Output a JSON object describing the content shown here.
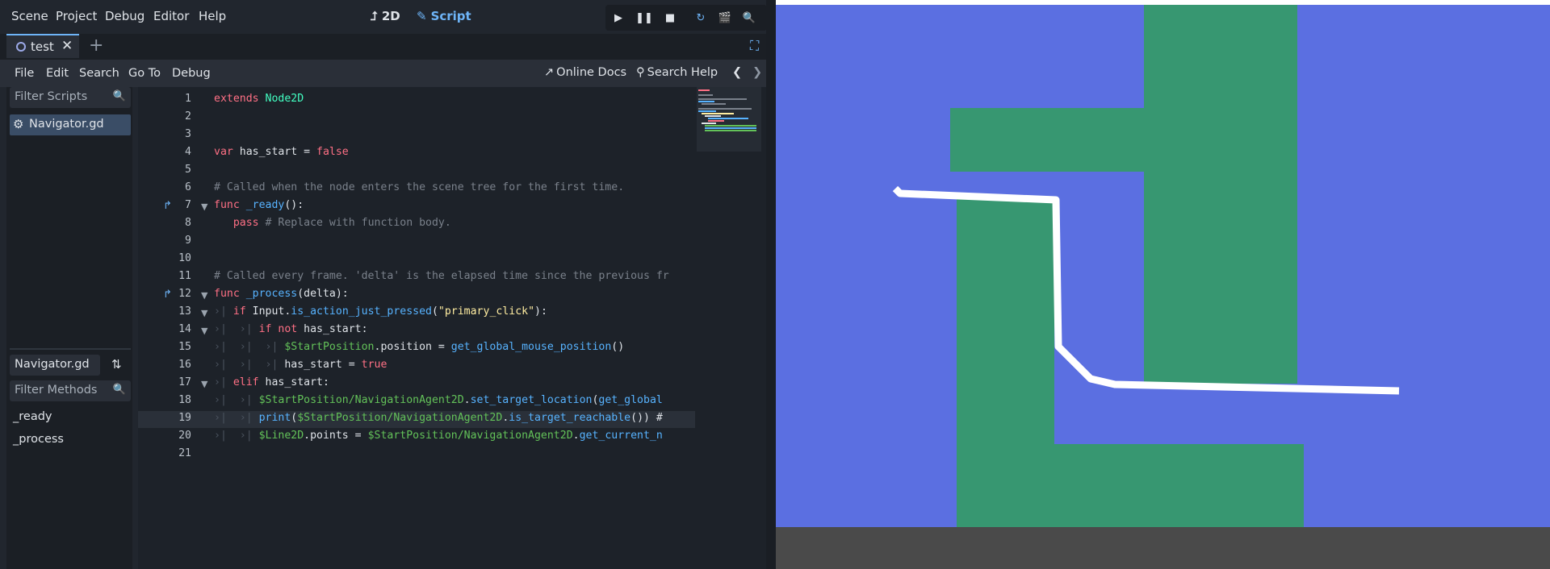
{
  "menubar": {
    "items": [
      "Scene",
      "Project",
      "Debug",
      "Editor",
      "Help"
    ],
    "workspace_2d": "2D",
    "workspace_script": "Script",
    "run_icons": [
      "play-icon",
      "pause-icon",
      "stop-icon",
      "reload-icon",
      "movie-icon",
      "zoom-icon"
    ]
  },
  "tabs": {
    "active": "test"
  },
  "script_menu": {
    "items": [
      "File",
      "Edit",
      "Search",
      "Go To",
      "Debug"
    ],
    "online_docs": "Online Docs",
    "search_help": "Search Help"
  },
  "scripts": {
    "filter_placeholder": "Filter Scripts",
    "items": [
      "Navigator.gd"
    ]
  },
  "methods": {
    "current_script": "Navigator.gd",
    "filter_placeholder": "Filter Methods",
    "items": [
      "_ready",
      "_process"
    ]
  },
  "code": {
    "line_numbers": [
      "1",
      "2",
      "3",
      "4",
      "5",
      "6",
      "7",
      "8",
      "9",
      "10",
      "11",
      "12",
      "13",
      "14",
      "15",
      "16",
      "17",
      "18",
      "19",
      "20",
      "21"
    ],
    "l1": {
      "kw": "extends",
      "ty": "Node2D"
    },
    "l4": {
      "kw": "var",
      "name": " has_start = ",
      "val": "false"
    },
    "l6": "# Called when the node enters the scene tree for the first time.",
    "l7": {
      "kw": "func",
      "name": " _ready",
      "rest": "():"
    },
    "l8": {
      "kw": "pass",
      "cm": " # Replace with function body."
    },
    "l11": "# Called every frame. 'delta' is the elapsed time since the previous fr",
    "l12": {
      "kw": "func",
      "name": " _process",
      "rest": "(delta):"
    },
    "l13": {
      "kw": "if",
      "a": " Input.",
      "b": "is_action_just_pressed",
      "c": "(",
      "d": "\"primary_click\"",
      "e": "):"
    },
    "l14": {
      "kw": "if not",
      "rest": " has_start:"
    },
    "l15": {
      "a": "$StartPosition",
      "b": ".position = ",
      "c": "get_global_mouse_position",
      "d": "()"
    },
    "l16": {
      "a": "has_start = ",
      "b": "true"
    },
    "l17": {
      "kw": "elif",
      "rest": " has_start:"
    },
    "l18": {
      "a": "$StartPosition/NavigationAgent2D",
      "b": ".",
      "c": "set_target_location",
      "d": "(",
      "e": "get_global"
    },
    "l19": {
      "a": "print",
      "b": "(",
      "c": "$StartPosition/NavigationAgent2D",
      "d": ".",
      "e": "is_target_reachable",
      "f": "()) #"
    },
    "l20": {
      "a": "$Line2D",
      "b": ".points = ",
      "c": "$StartPosition/NavigationAgent2D",
      "d": ".",
      "e": "get_current_n"
    }
  },
  "colors": {
    "accent": "#6eb4f7",
    "keyword": "#ff7085",
    "type": "#42ffc2",
    "node_path": "#63c259",
    "function": "#57b3ff",
    "string": "#ffeda1",
    "comment": "#7a818b",
    "game_background": "#5b6fe1",
    "game_walls": "#379771",
    "nav_path": "#ffffff"
  }
}
